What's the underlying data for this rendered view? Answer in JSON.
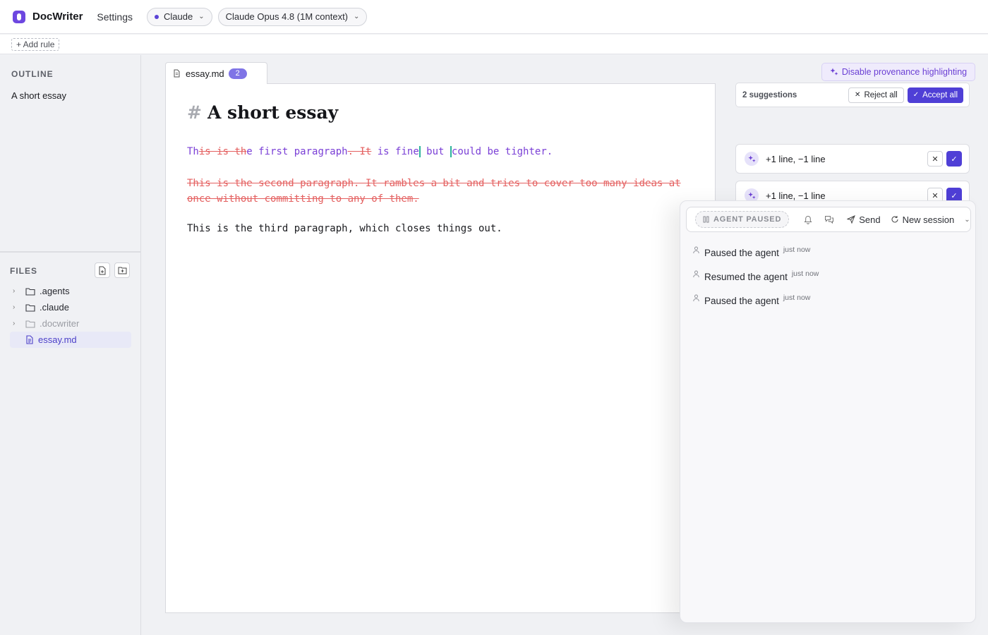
{
  "app": {
    "name": "DocWriter",
    "settings_label": "Settings"
  },
  "header": {
    "agent_pill": "Claude",
    "model_pill": "Claude Opus 4.8 (1M context)"
  },
  "rules": {
    "add_rule_label": "+ Add rule"
  },
  "sidebar": {
    "outline_title": "OUTLINE",
    "outline_items": [
      "A short essay"
    ],
    "files_title": "FILES",
    "files": [
      ".agents",
      ".claude",
      ".docwriter",
      "essay.md"
    ]
  },
  "editor": {
    "tab_label": "essay.md",
    "tab_badge": "2",
    "heading_hash": "#",
    "heading": "A short essay",
    "p1": {
      "s1": "Th",
      "d1": "is is th",
      "s2": "e first paragraph",
      "d2": ". It",
      "s3": " is fine",
      "s4": " but ",
      "s5": "could be tighter."
    },
    "p2": "This is the second paragraph. It rambles a bit and tries to cover too many ideas at once without committing to any of them.",
    "p3": "This is the third paragraph, which closes things out."
  },
  "review": {
    "provenance_label": "Disable provenance highlighting",
    "suggestions_count": "2 suggestions",
    "reject_all": "Reject all",
    "accept_all": "Accept all",
    "changes": [
      "+1 line, −1 line",
      "+1 line, −1 line"
    ]
  },
  "agent": {
    "status": "AGENT PAUSED",
    "send_label": "Send",
    "new_session_label": "New session",
    "activity": [
      {
        "text": "Paused the agent",
        "time": "just now"
      },
      {
        "text": "Resumed the agent",
        "time": "just now"
      },
      {
        "text": "Paused the agent",
        "time": "just now"
      }
    ]
  },
  "colors": {
    "accent": "#4f3fd6",
    "deletion": "#e46060",
    "insertion": "#7a3fd6"
  }
}
